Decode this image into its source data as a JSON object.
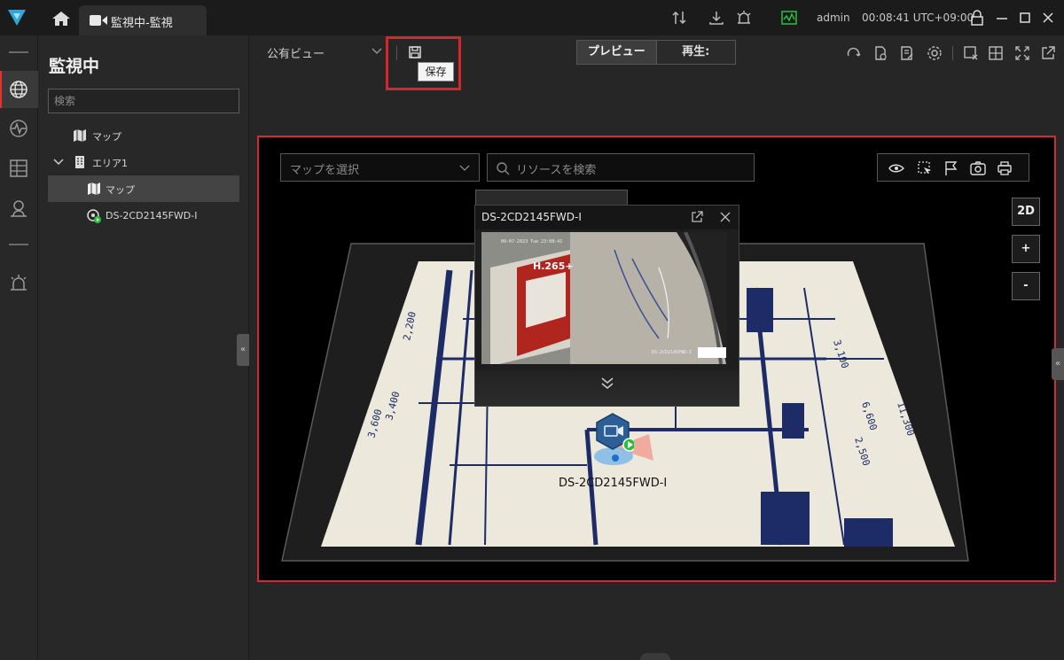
{
  "titlebar": {
    "tab_label": "監視中-監視",
    "user": "admin",
    "clock": "00:08:41 UTC+09:00"
  },
  "sidebar": {
    "title": "監視中",
    "search_placeholder": "検索",
    "tree": [
      {
        "label": "マップ"
      },
      {
        "label": "エリア1"
      },
      {
        "label": "マップ"
      },
      {
        "label": "DS-2CD2145FWD-I"
      }
    ]
  },
  "toolbar": {
    "view_name": "公有ビュー",
    "save_tooltip": "保存",
    "preview_label": "プレビュー",
    "playback_label": "再生:"
  },
  "map": {
    "select_placeholder": "マップを選択",
    "search_placeholder": "リソースを検索",
    "view_mode": "2D",
    "zoom_in": "+",
    "zoom_out": "-",
    "plan_dimensions": [
      "3,100",
      "6,600",
      "2,500",
      "11,300",
      "3,400",
      "3,600",
      "2,200"
    ],
    "device_label": "DS-2CD2145FWD-I"
  },
  "popup": {
    "title": "DS-2CD2145FWD-I",
    "osd_time": "09-07-2023 Tue 23:08:41",
    "osd_name": "DS-2CD2145FWD-I",
    "box_text": "H.265+"
  },
  "colors": {
    "highlight": "#d9242b",
    "accent_logo": "#2fa6d6",
    "status_green": "#27c23c"
  }
}
